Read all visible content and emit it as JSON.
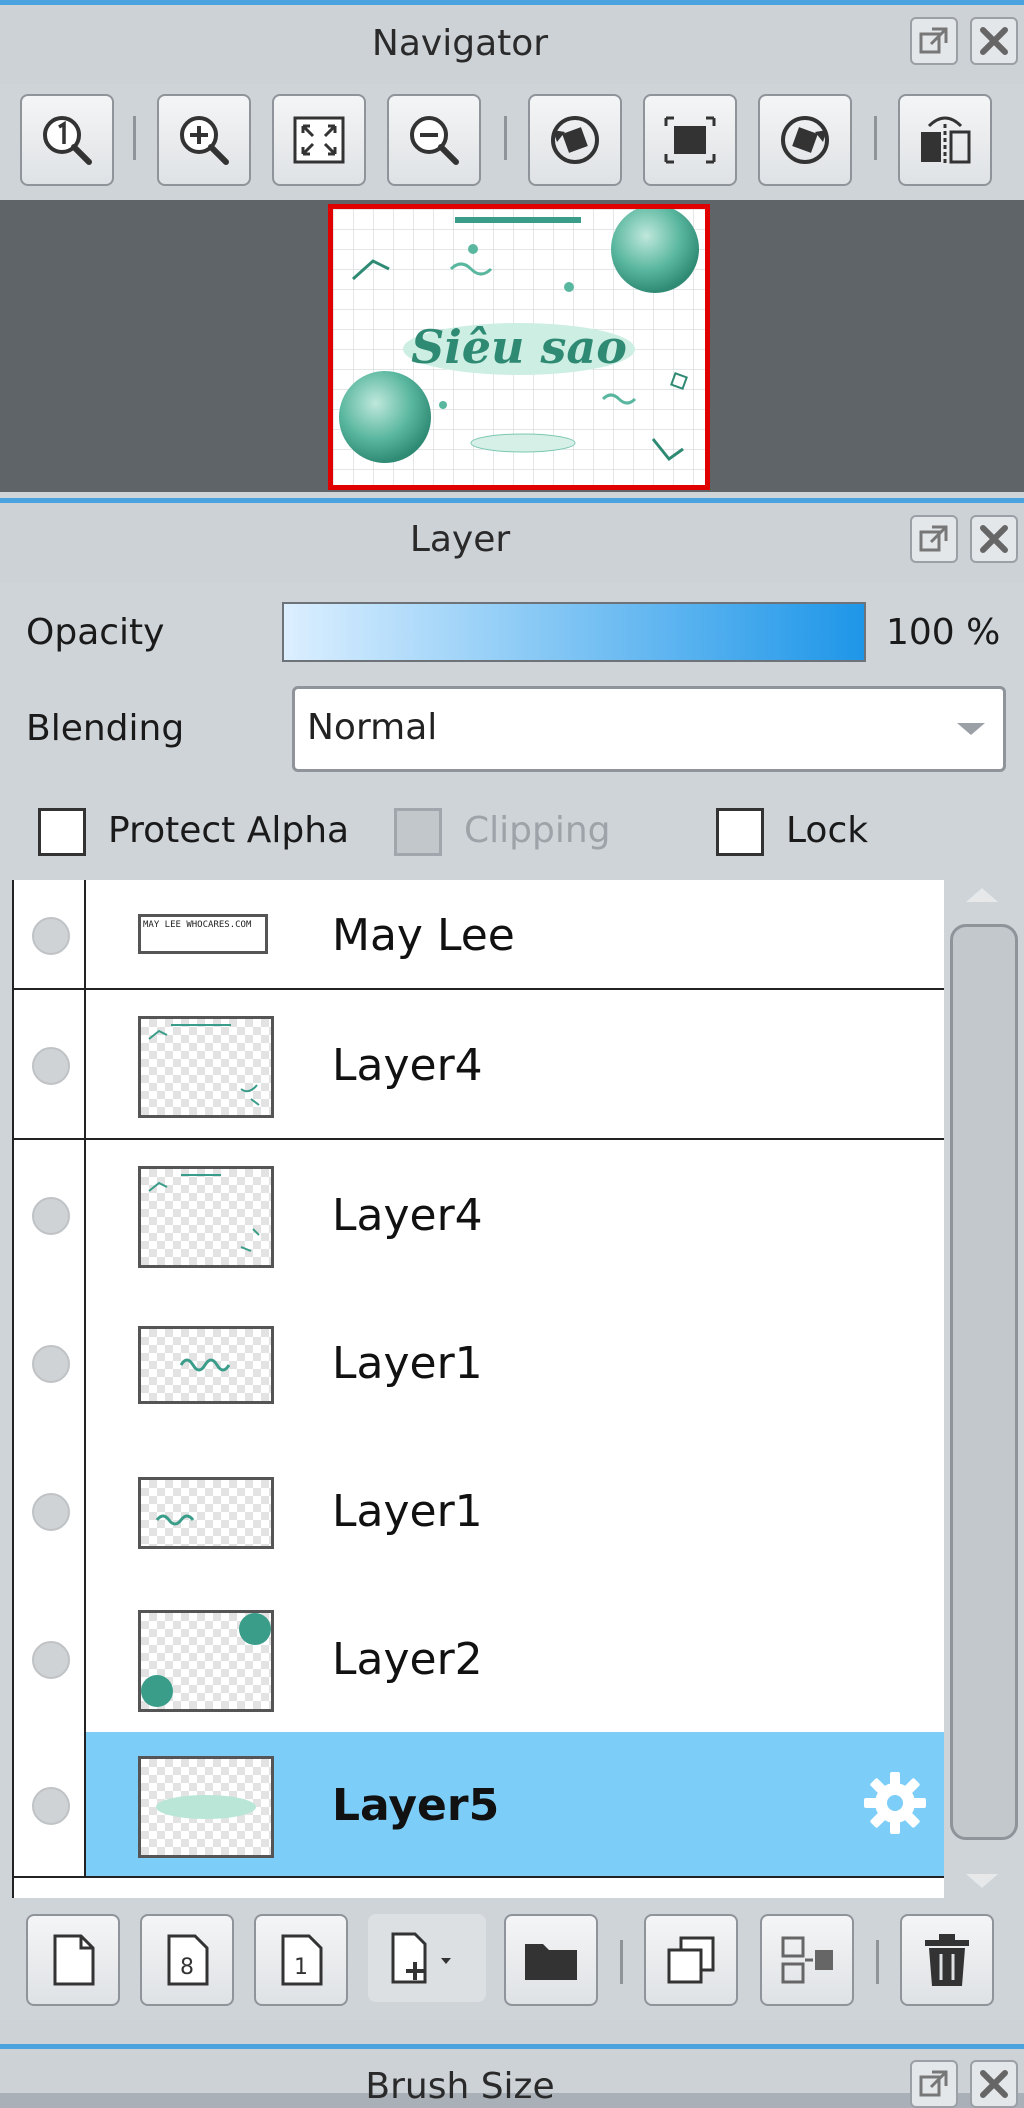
{
  "navigator": {
    "title": "Navigator",
    "toolbar_icons": [
      "zoom-reset-icon",
      "zoom-in-icon",
      "fit-view-icon",
      "zoom-out-icon",
      "rotate-left-icon",
      "fit-screen-icon",
      "rotate-right-icon",
      "flip-horizontal-icon"
    ],
    "preview_text": "Siêu sao"
  },
  "layer_panel": {
    "title": "Layer",
    "opacity_label": "Opacity",
    "opacity_value": "100 %",
    "opacity_fraction": 1.0,
    "blending_label": "Blending",
    "blending_value": "Normal",
    "protect_alpha_label": "Protect Alpha",
    "clipping_label": "Clipping",
    "lock_label": "Lock",
    "layers": [
      {
        "name": "May Lee",
        "thumb_text": "MAY LEE WHOCARES.COM"
      },
      {
        "name": "Layer4"
      },
      {
        "name": "Layer4"
      },
      {
        "name": "Layer1"
      },
      {
        "name": "Layer1"
      },
      {
        "name": "Layer2"
      },
      {
        "name": "Layer5",
        "selected": true
      }
    ],
    "bottom_icons": [
      "new-layer-icon",
      "new-8bit-layer-icon",
      "new-1bit-layer-icon",
      "add-layer-menu-icon",
      "new-folder-icon",
      "duplicate-layer-icon",
      "merge-down-icon",
      "delete-layer-icon"
    ]
  },
  "brush_panel": {
    "title": "Brush Size"
  },
  "colors": {
    "accent": "#4aa3de",
    "selection": "#7ccdf7",
    "nav_frame": "#e00000",
    "teal": "#3a9d8a"
  }
}
